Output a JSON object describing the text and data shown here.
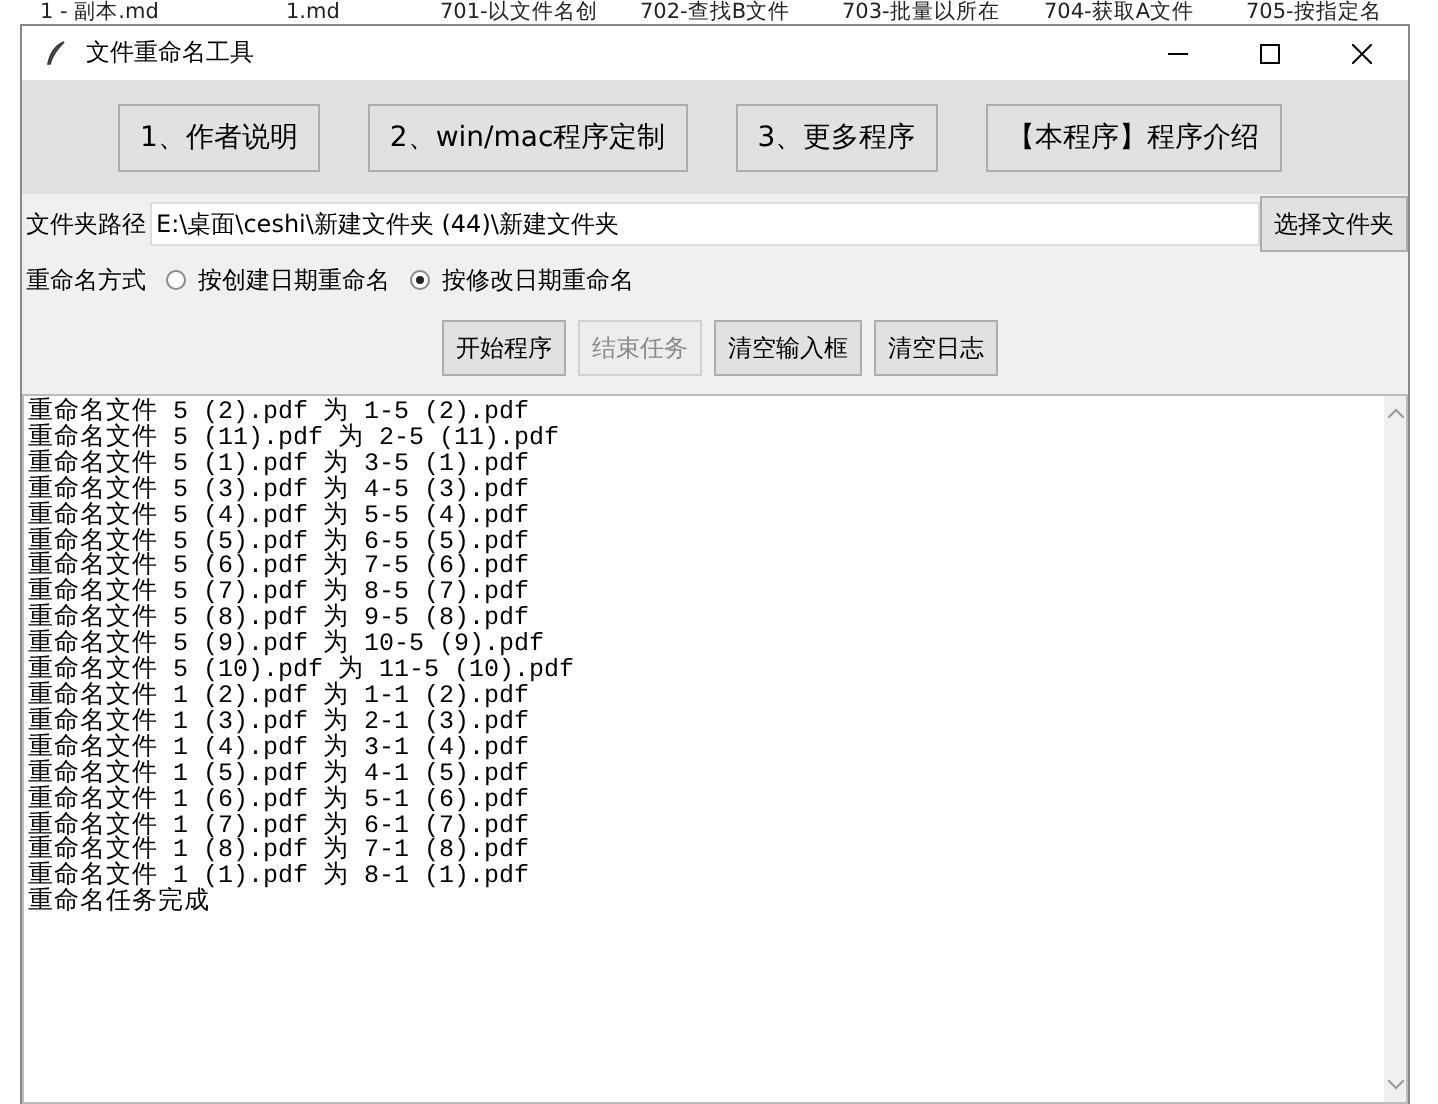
{
  "desktop_labels": [
    "1 - 副本.md",
    "1.md",
    "701-以文件名创",
    "702-查找B文件",
    "703-批量以所在",
    "704-获取A文件",
    "705-按指定名"
  ],
  "window": {
    "title": "文件重命名工具"
  },
  "top_buttons": [
    "1、作者说明",
    "2、win/mac程序定制",
    "3、更多程序",
    "【本程序】程序介绍"
  ],
  "path": {
    "label": "文件夹路径",
    "value": "E:\\桌面\\ceshi\\新建文件夹 (44)\\新建文件夹",
    "button": "选择文件夹"
  },
  "rename_mode": {
    "label": "重命名方式",
    "options": [
      {
        "label": "按创建日期重命名",
        "selected": false
      },
      {
        "label": "按修改日期重命名",
        "selected": true
      }
    ]
  },
  "actions": [
    {
      "label": "开始程序",
      "disabled": false
    },
    {
      "label": "结束任务",
      "disabled": true
    },
    {
      "label": "清空输入框",
      "disabled": false
    },
    {
      "label": "清空日志",
      "disabled": false
    }
  ],
  "log": {
    "lines": [
      "重命名文件 5 (2).pdf 为 1-5 (2).pdf",
      "重命名文件 5 (11).pdf 为 2-5 (11).pdf",
      "重命名文件 5 (1).pdf 为 3-5 (1).pdf",
      "重命名文件 5 (3).pdf 为 4-5 (3).pdf",
      "重命名文件 5 (4).pdf 为 5-5 (4).pdf",
      "重命名文件 5 (5).pdf 为 6-5 (5).pdf",
      "重命名文件 5 (6).pdf 为 7-5 (6).pdf",
      "重命名文件 5 (7).pdf 为 8-5 (7).pdf",
      "重命名文件 5 (8).pdf 为 9-5 (8).pdf",
      "重命名文件 5 (9).pdf 为 10-5 (9).pdf",
      "重命名文件 5 (10).pdf 为 11-5 (10).pdf",
      "重命名文件 1 (2).pdf 为 1-1 (2).pdf",
      "重命名文件 1 (3).pdf 为 2-1 (3).pdf",
      "重命名文件 1 (4).pdf 为 3-1 (4).pdf",
      "重命名文件 1 (5).pdf 为 4-1 (5).pdf",
      "重命名文件 1 (6).pdf 为 5-1 (6).pdf",
      "重命名文件 1 (7).pdf 为 6-1 (7).pdf",
      "重命名文件 1 (8).pdf 为 7-1 (8).pdf",
      "重命名文件 1 (1).pdf 为 8-1 (1).pdf",
      "重命名任务完成"
    ]
  }
}
